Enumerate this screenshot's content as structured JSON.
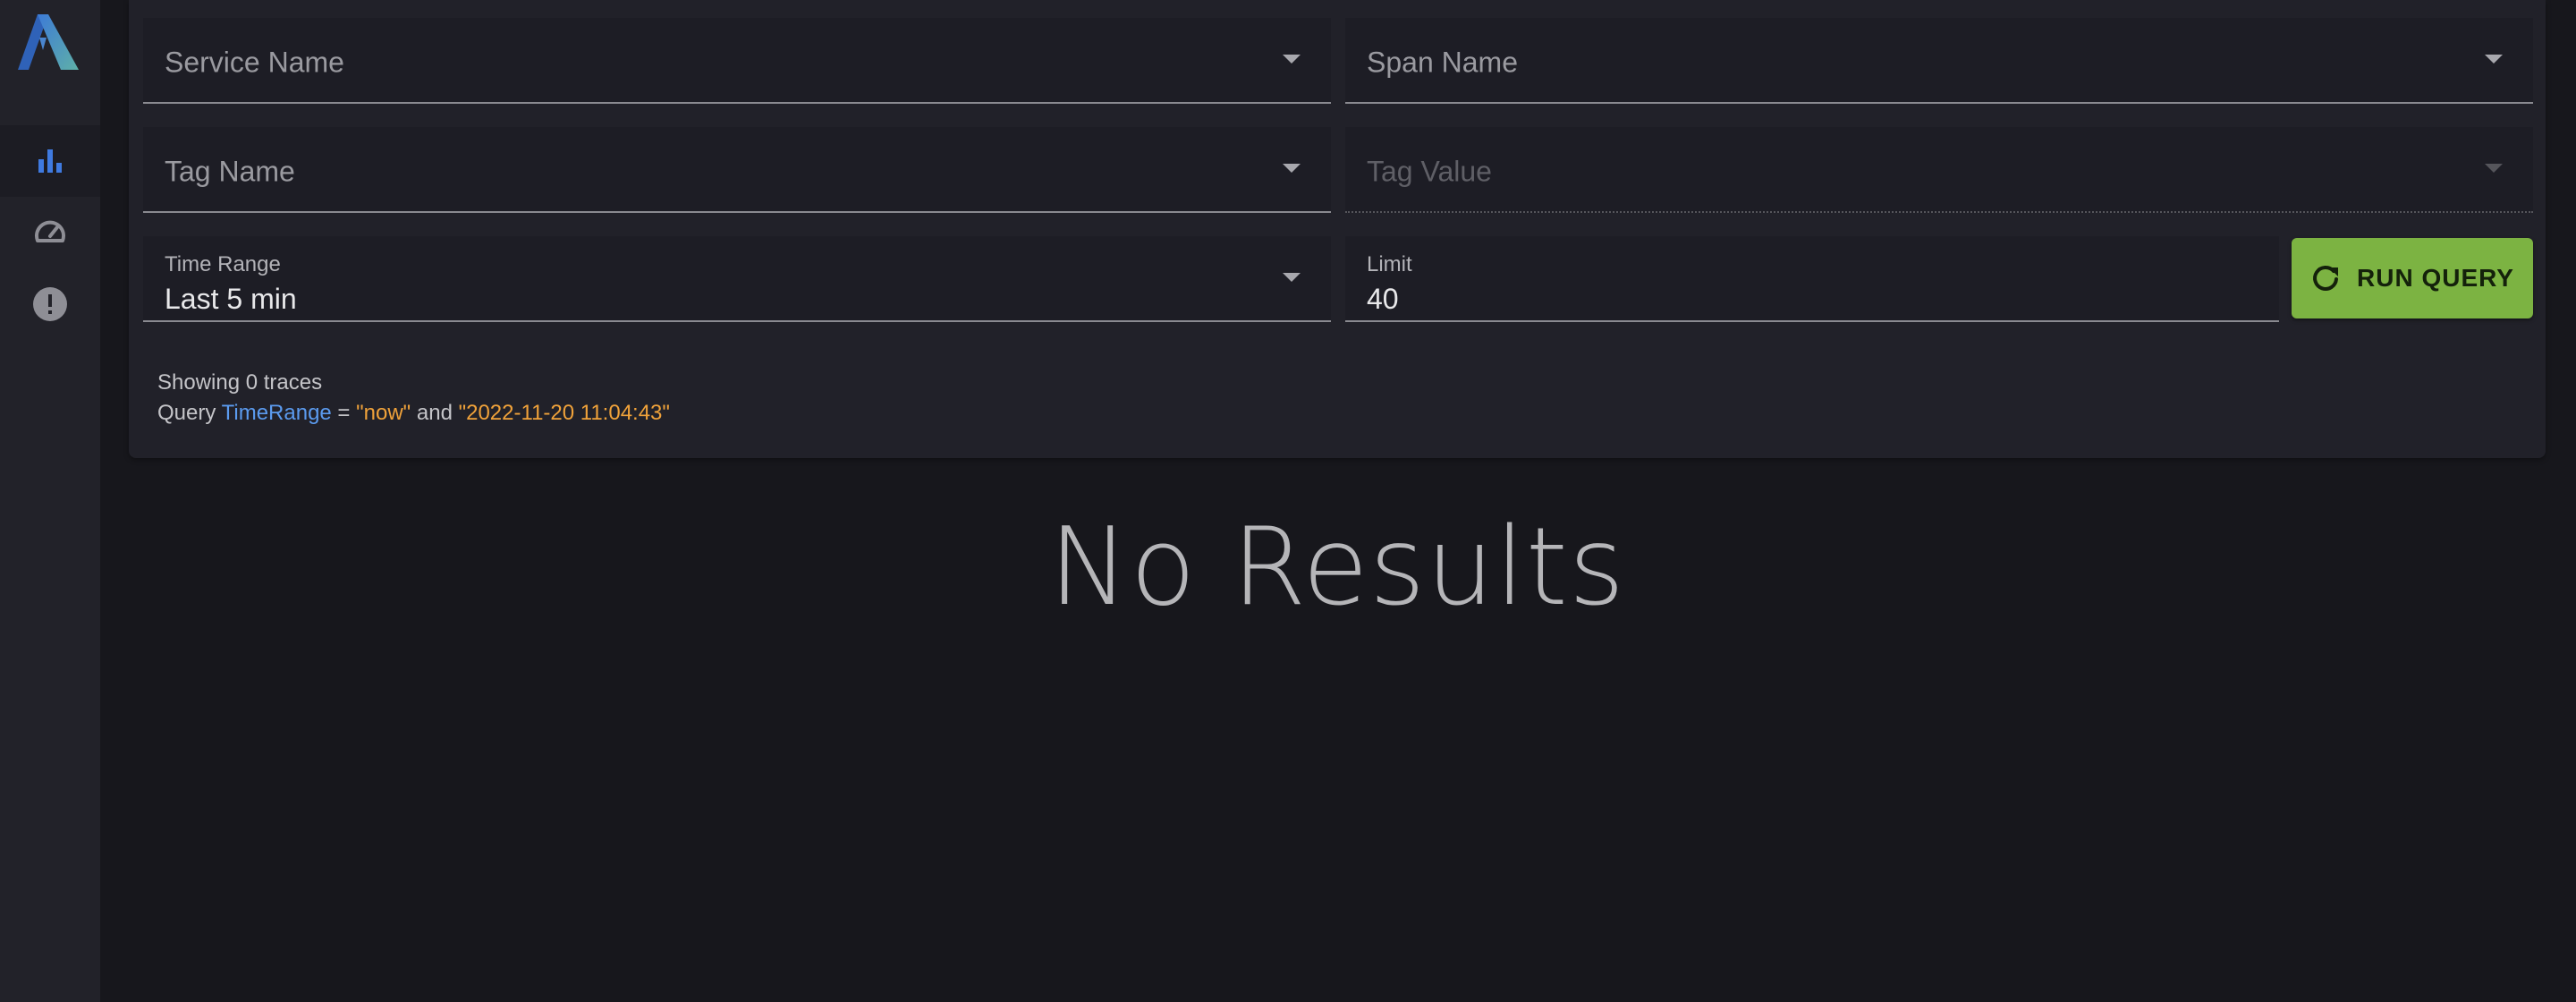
{
  "sidebar": {
    "logo_icon": "app-logo",
    "items": [
      {
        "icon": "bar-chart-icon",
        "active": true
      },
      {
        "icon": "speedometer-icon",
        "active": false
      },
      {
        "icon": "alert-circle-icon",
        "active": false
      }
    ],
    "accent": "#3f7ae0"
  },
  "filters": {
    "service_name": {
      "placeholder": "Service Name"
    },
    "span_name": {
      "placeholder": "Span Name"
    },
    "tag_name": {
      "placeholder": "Tag Name"
    },
    "tag_value": {
      "placeholder": "Tag Value",
      "disabled": true
    },
    "time_range": {
      "label": "Time Range",
      "value": "Last 5 min"
    },
    "limit": {
      "label": "Limit",
      "value": "40"
    }
  },
  "run_query": {
    "label": "RUN QUERY",
    "icon": "refresh-icon",
    "color": "#7cb342"
  },
  "summary": {
    "status": "Showing 0 traces",
    "query_prefix": "Query ",
    "query_key": "TimeRange",
    "query_op": " = ",
    "query_from": "\"now\"",
    "query_and": " and ",
    "query_to": "\"2022-11-20 11:04:43\""
  },
  "results": {
    "empty_text": "No Results"
  }
}
